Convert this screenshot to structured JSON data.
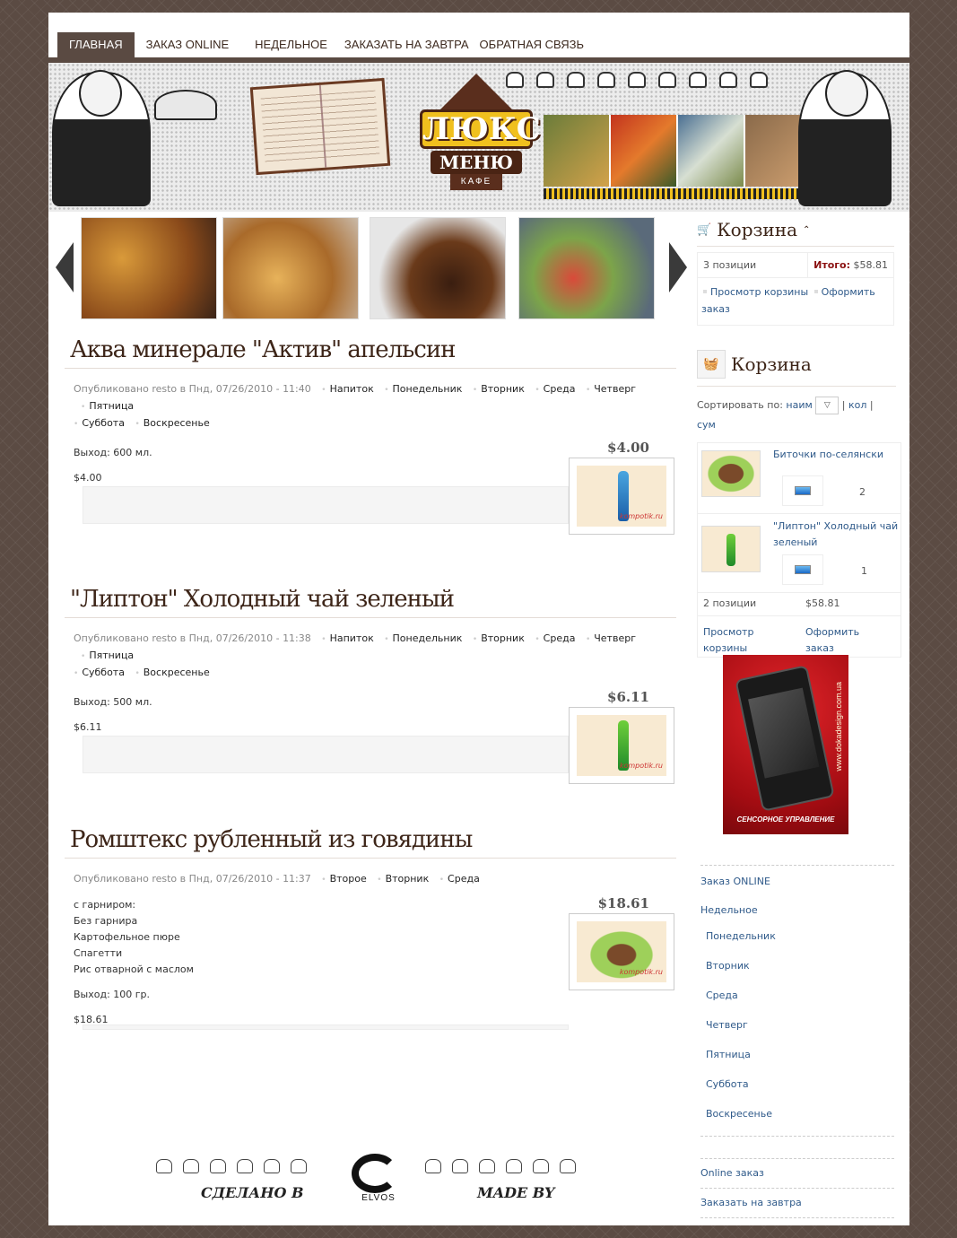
{
  "nav": {
    "items": [
      {
        "label": "ГЛАВНАЯ",
        "active": true
      },
      {
        "label": "ЗАКАЗ ONLINE",
        "active": false
      },
      {
        "label": "НЕДЕЛЬНОЕ",
        "active": false
      },
      {
        "label": "ЗАКАЗАТЬ НА ЗАВТРА",
        "active": false
      },
      {
        "label": "ОБРАТНАЯ СВЯЗЬ",
        "active": false
      }
    ]
  },
  "banner": {
    "logo_main": "ЛЮКС",
    "logo_sub": "МЕНЮ",
    "logo_cafe": "КАФЕ"
  },
  "nodes": [
    {
      "title": "Аква минерале \"Актив\" апельсин",
      "published": "Опубликовано resto в Пнд, 07/26/2010 - 11:40",
      "tags": [
        "Напиток",
        "Понедельник",
        "Вторник",
        "Среда",
        "Четверг",
        "Пятница",
        "Суббота",
        "Воскресенье"
      ],
      "lines": [
        "Выход: 600 мл."
      ],
      "price_small": "$4.00",
      "price_big": "$4.00",
      "image_watermark": "kompotik.ru"
    },
    {
      "title": "\"Липтон\" Холодный чай зеленый",
      "published": "Опубликовано resto в Пнд, 07/26/2010 - 11:38",
      "tags": [
        "Напиток",
        "Понедельник",
        "Вторник",
        "Среда",
        "Четверг",
        "Пятница",
        "Суббота",
        "Воскресенье"
      ],
      "lines": [
        "Выход: 500 мл."
      ],
      "price_small": "$6.11",
      "price_big": "$6.11",
      "image_watermark": "kompotik.ru"
    },
    {
      "title": "Ромштекс рубленный из говядины",
      "published": "Опубликовано resto в Пнд, 07/26/2010 - 11:37",
      "tags": [
        "Второе",
        "Вторник",
        "Среда"
      ],
      "lines": [
        "с гарниром:",
        "Без гарнира",
        "Картофельное пюре",
        "Спагетти",
        "Рис отварной с маслом"
      ],
      "extra_line": "Выход: 100 гр.",
      "price_small": "$18.61",
      "price_big": "$18.61",
      "image_watermark": "kompotik.ru"
    }
  ],
  "cart_summary": {
    "title": "Корзина",
    "positions": "3 позиции",
    "total_label": "Итого:",
    "total_value": "$58.81",
    "view_link": "Просмотр корзины",
    "checkout_link": "Оформить заказ"
  },
  "cart_block": {
    "title": "Корзина",
    "sort_label": "Сортировать по:",
    "sort_selected": "наим",
    "sort_kol": "кол",
    "sort_sum": "сум",
    "items": [
      {
        "name": "Биточки по-селянски",
        "qty": "2"
      },
      {
        "name": "\"Липтон\" Холодный чай зеленый",
        "qty": "1"
      }
    ],
    "positions": "2 позиции",
    "total": "$58.81",
    "view_link": "Просмотр корзины",
    "checkout_link": "Оформить заказ"
  },
  "ad": {
    "caption": "СЕНСОРНОЕ УПРАВЛЕНИЕ",
    "vertical": "www.dokadesign.com.ua"
  },
  "side_menu": {
    "order_online": "Заказ ONLINE",
    "weekly": "Недельное",
    "days": [
      "Понедельник",
      "Вторник",
      "Среда",
      "Четверг",
      "Пятница",
      "Суббота",
      "Воскресенье"
    ],
    "online_order": "Online заказ",
    "order_tomorrow": "Заказать на завтра"
  },
  "footer": {
    "made_in": "СДЕЛАНО В",
    "made_by": "MADE BY",
    "brand": "ELVOS"
  }
}
